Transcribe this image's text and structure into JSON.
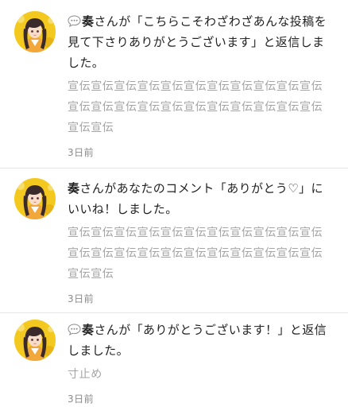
{
  "notifications": [
    {
      "type": "reply",
      "user": "奏",
      "action_text": "さんが「こちらこそわざわざあんな投稿を見て下さりありがとうございます」と返信しました。",
      "quote": "宣伝宣伝宣伝宣伝宣伝宣伝宣伝宣伝宣伝宣伝宣伝宣伝宣伝宣伝宣伝宣伝宣伝宣伝宣伝宣伝宣伝宣伝宣伝宣伝",
      "time": "3日前"
    },
    {
      "type": "like",
      "user": "奏",
      "action_text": "さんがあなたのコメント「ありがとう♡」にいいね！しました。",
      "quote": "宣伝宣伝宣伝宣伝宣伝宣伝宣伝宣伝宣伝宣伝宣伝宣伝宣伝宣伝宣伝宣伝宣伝宣伝宣伝宣伝宣伝宣伝宣伝宣伝",
      "time": "3日前"
    },
    {
      "type": "reply",
      "user": "奏",
      "action_text": "さんが「ありがとうございます！」と返信しました。",
      "quote": "寸止め",
      "time": "3日前"
    }
  ],
  "icons": {
    "reply": "speech-bubble-icon",
    "avatar": "user-avatar"
  },
  "colors": {
    "text": "#222222",
    "quote": "#a4a4a4",
    "time": "#8a8a8a",
    "divider": "#e6e6e6",
    "avatar_bg": "#f3c81f"
  }
}
